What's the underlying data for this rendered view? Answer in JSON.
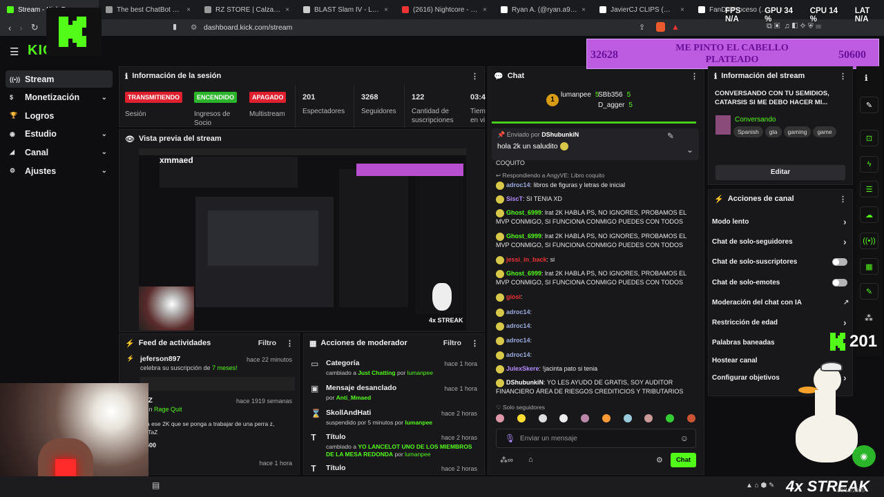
{
  "tabs": [
    {
      "title": "Stream - Kick Dashboard",
      "color": "#53fc18",
      "active": true
    },
    {
      "title": "The best ChatBot and Widgets",
      "color": "#999"
    },
    {
      "title": "RZ STORE | Calzado de platafo",
      "color": "#999"
    },
    {
      "title": "BLAST Slam IV - Liquipedia Do",
      "color": "#ccc"
    },
    {
      "title": "(2616) Nightcore - Butterfly (L",
      "color": "#e33"
    },
    {
      "title": "Ryan A. (@ryan.a92) | TikTok",
      "color": "#fff"
    },
    {
      "title": "JavierCJ CLIPS (@javiercj774)",
      "color": "#fff"
    },
    {
      "title": "FanDelProceso (@fandelproceso",
      "color": "#fff"
    }
  ],
  "overlay": {
    "fps_label": "FPS",
    "fps": "N/A",
    "gpu_label": "GPU",
    "gpu": "34 %",
    "cpu_label": "CPU",
    "cpu": "14 %",
    "lat_label": "LAT",
    "lat": "N/A"
  },
  "url": "dashboard.kick.com/stream",
  "logo_text": "KICK",
  "sidebar": [
    {
      "label": "Stream",
      "icon": "stream-icon",
      "active": true
    },
    {
      "label": "Monetización",
      "icon": "money-icon",
      "chev": true
    },
    {
      "label": "Logros",
      "icon": "trophy-icon"
    },
    {
      "label": "Estudio",
      "icon": "studio-icon",
      "chev": true
    },
    {
      "label": "Canal",
      "icon": "channel-icon",
      "chev": true
    },
    {
      "label": "Ajustes",
      "icon": "gear-icon",
      "chev": true
    }
  ],
  "session": {
    "title": "Información de la sesión",
    "badges": [
      {
        "text": "TRANSMITIENDO",
        "color": "#e0202e",
        "label": "Sesión"
      },
      {
        "text": "ENCENDIDO",
        "color": "#2bb52b",
        "label": "Ingresos de Socio"
      },
      {
        "text": "APAGADO",
        "color": "#e0202e",
        "label": "Multistream"
      }
    ],
    "stats": [
      {
        "value": "201",
        "label": "Espectadores"
      },
      {
        "value": "3268",
        "label": "Seguidores"
      },
      {
        "value": "122",
        "label": "Cantidad de suscripciones"
      },
      {
        "value": "03:4",
        "label": "Tiem en vi"
      }
    ]
  },
  "preview": {
    "title": "Vista previa del stream",
    "channel": "xmmaed"
  },
  "banner": {
    "left": "32628",
    "center": "ME PINTO EL CABELLO PLATEADO",
    "right": "50600"
  },
  "feed": {
    "title": "Feed de actividades",
    "filter": "Filtro",
    "items": [
      {
        "name": "jeferson897",
        "time": "hace 22 minutos",
        "sub_a": "celebra su suscripción de ",
        "sub_b": "7 meses!"
      },
      {
        "name": "TaZ",
        "time": "hace 1919 semanas",
        "sub_a": "ó un ",
        "sub_b": "Rage Quit",
        "extra": "le a ese 2K que se ponga a trabajar de una perra z, yo TaZ",
        "amount": "500"
      },
      {
        "name": "aZ",
        "time": "hace 1 hora",
        "sub_a": "",
        "sub_b": ""
      }
    ]
  },
  "mod": {
    "title": "Acciones de moderador",
    "filter": "Filtro",
    "items": [
      {
        "name": "Categoría",
        "time": "hace 1 hora",
        "a": "cambiado a ",
        "b": "Just Chatting",
        "c": " por ",
        "d": "lumanpee"
      },
      {
        "name": "Mensaje desanclado",
        "time": "hace 1 hora",
        "a": "por ",
        "b": "Anti_Mmaed",
        "c": "",
        "d": ""
      },
      {
        "name": "SkollAndHati",
        "time": "hace 2 horas",
        "a": "suspendido por 5 minutos por ",
        "b": "lumanpee",
        "c": "",
        "d": ""
      },
      {
        "name": "Título",
        "time": "hace 2 horas",
        "a": "cambiado a ",
        "b": "YO LANCELOT UNO DE LOS MIEMBROS DE LA MESA REDONDA",
        "c": " por ",
        "d": "lumanpee"
      },
      {
        "name": "Título",
        "time": "hace 2 horas",
        "a": "",
        "b": "",
        "c": "",
        "d": ""
      }
    ]
  },
  "chat": {
    "title": "Chat",
    "leaders": [
      {
        "name": "lumanpee",
        "count": "5"
      },
      {
        "name": "SBb356",
        "count": "5"
      },
      {
        "name": "D_agger",
        "count": "5"
      }
    ],
    "leader_rank": "1",
    "pinned_by": "Enviado por ",
    "pinned_user": "DShubunkiN",
    "pinned_msg": "hola 2k un saludito",
    "top_fragment": "COQUITO",
    "reply": "Respondiendo a AngyVE: Libro coquito",
    "messages": [
      {
        "user": "adroc14",
        "color": "#9ad",
        "text": "libros de figuras y letras de inicial"
      },
      {
        "user": "SiscT",
        "color": "#b28cff",
        "text": "SI TENIA XD"
      },
      {
        "user": "Ghost_6999",
        "color": "#53fc18",
        "text": "lrat 2K HABLA PS, NO IGNORES, PROBAMOS EL MVP CONMIGO, SI FUNCIONA CONMIGO PUEDES CON TODOS"
      },
      {
        "user": "Ghost_6999",
        "color": "#53fc18",
        "text": "lrat 2K HABLA PS, NO IGNORES, PROBAMOS EL MVP CONMIGO, SI FUNCIONA CONMIGO PUEDES CON TODOS"
      },
      {
        "user": "jessi_in_back",
        "color": "#e33",
        "text": "si"
      },
      {
        "user": "Ghost_6999",
        "color": "#53fc18",
        "text": "lrat 2K HABLA PS, NO IGNORES, PROBAMOS EL MVP CONMIGO, SI FUNCIONA CONMIGO PUEDES CON TODOS"
      },
      {
        "user": "giosi",
        "color": "#e33",
        "text": ""
      },
      {
        "user": "adroc14",
        "color": "#9ad",
        "text": ""
      },
      {
        "user": "adroc14",
        "color": "#9ad",
        "text": ""
      },
      {
        "user": "adroc14",
        "color": "#9ad",
        "text": ""
      },
      {
        "user": "adroc14",
        "color": "#9ad",
        "text": ""
      },
      {
        "user": "JulexSkere",
        "color": "#b28cff",
        "text": "!jacinta pato si tenia"
      },
      {
        "user": "DShubunkiN",
        "color": "#fff",
        "text": "YO LES AYUDO DE GRATIS, SOY AUDITOR FINANCIERO ÁREA DE RIESGOS CREDITICIOS Y TRIBUTARIOS"
      }
    ],
    "mode": "Solo seguidores",
    "input_placeholder": "Enviar un mensaje",
    "send": "Chat"
  },
  "streaminfo": {
    "title": "Información del stream",
    "stream_title": "CONVERSANDO CON TU SEMIDIOS, CATARSIS SI ME DEBO HACER MI...",
    "category": "Conversando",
    "tags": [
      "Spanish",
      "gta",
      "gaming",
      "game"
    ],
    "edit": "Editar"
  },
  "actions": {
    "title": "Acciones de canal",
    "items": [
      {
        "label": "Modo lento",
        "ctl": "arrow"
      },
      {
        "label": "Chat de solo-seguidores",
        "ctl": "arrow"
      },
      {
        "label": "Chat de solo-suscriptores",
        "ctl": "toggle"
      },
      {
        "label": "Chat de solo-emotes",
        "ctl": "toggle"
      },
      {
        "label": "Moderación del chat con IA",
        "ctl": "ext"
      },
      {
        "label": "Restricción de edad",
        "ctl": "arrow"
      },
      {
        "label": "Palabras baneadas",
        "ctl": "none"
      },
      {
        "label": "Hostear canal",
        "ctl": "none"
      },
      {
        "label": "Configurar objetivos",
        "ctl": "arrow"
      }
    ]
  },
  "viewer_overlay": "201",
  "streak": "4x STREAK",
  "taskbar_date": "16/10/2025",
  "colors": {
    "accent": "#53fc18",
    "live_red": "#e0202e",
    "panel": "#18181b"
  }
}
